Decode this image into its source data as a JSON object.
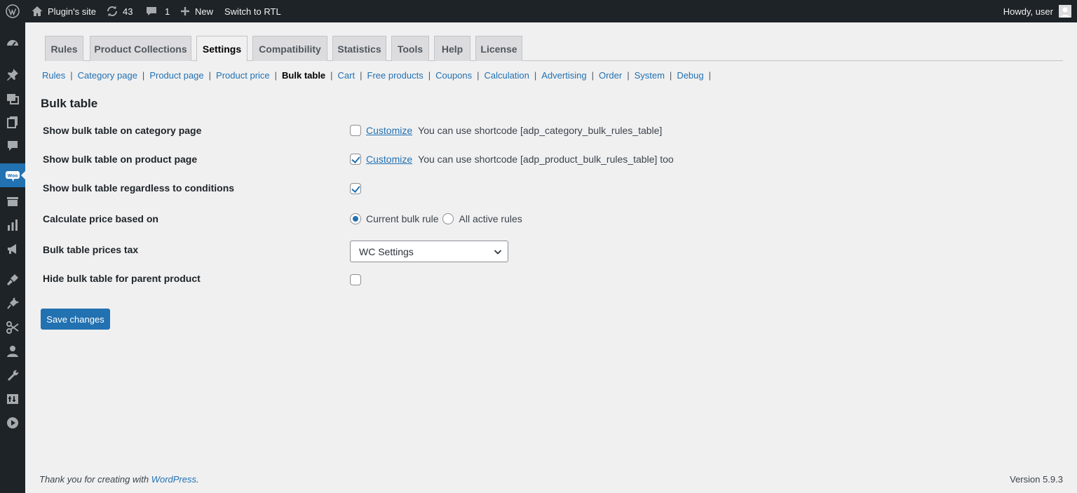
{
  "admin_bar": {
    "site_name": "Plugin's site",
    "updates_count": "43",
    "comments_count": "1",
    "new_label": "New",
    "rtl_label": "Switch to RTL",
    "howdy": "Howdy, user"
  },
  "sidebar_icons": [
    "dashboard-icon",
    "pin-icon",
    "media-icon",
    "pages-icon",
    "comments-icon",
    "woocommerce-icon",
    "products-icon",
    "analytics-icon",
    "marketing-icon",
    "appearance-icon",
    "plugins-icon",
    "tools-scissors-icon",
    "users-icon",
    "wrench-icon",
    "settings-icon",
    "play-icon"
  ],
  "tabs": [
    {
      "label": "Rules"
    },
    {
      "label": "Product Collections"
    },
    {
      "label": "Settings",
      "active": true
    },
    {
      "label": "Compatibility"
    },
    {
      "label": "Statistics"
    },
    {
      "label": "Tools"
    },
    {
      "label": "Help"
    },
    {
      "label": "License"
    }
  ],
  "subsub": [
    "Rules",
    "Category page",
    "Product page",
    "Product price",
    "Bulk table",
    "Cart",
    "Free products",
    "Coupons",
    "Calculation",
    "Advertising",
    "Order",
    "System",
    "Debug"
  ],
  "subsub_active": "Bulk table",
  "heading": "Bulk table",
  "settings": {
    "category_page": {
      "label": "Show bulk table on category page",
      "checked": false,
      "customize": "Customize",
      "note": "You can use shortcode [adp_category_bulk_rules_table]"
    },
    "product_page": {
      "label": "Show bulk table on product page",
      "checked": true,
      "customize": "Customize",
      "note": "You can use shortcode [adp_product_bulk_rules_table] too"
    },
    "regardless": {
      "label": "Show bulk table regardless to conditions",
      "checked": true
    },
    "calculate": {
      "label": "Calculate price based on",
      "options": [
        "Current bulk rule",
        "All active rules"
      ],
      "selected": "Current bulk rule"
    },
    "tax": {
      "label": "Bulk table prices tax",
      "value": "WC Settings"
    },
    "hide_parent": {
      "label": "Hide bulk table for parent product",
      "checked": false
    }
  },
  "save_label": "Save changes",
  "footer": {
    "thanks_prefix": "Thank you for creating with ",
    "thanks_link": "WordPress",
    "thanks_suffix": ".",
    "version": "Version 5.9.3"
  },
  "colors": {
    "accent": "#2271b1",
    "adminbar": "#1d2327",
    "background": "#f0f0f1"
  }
}
